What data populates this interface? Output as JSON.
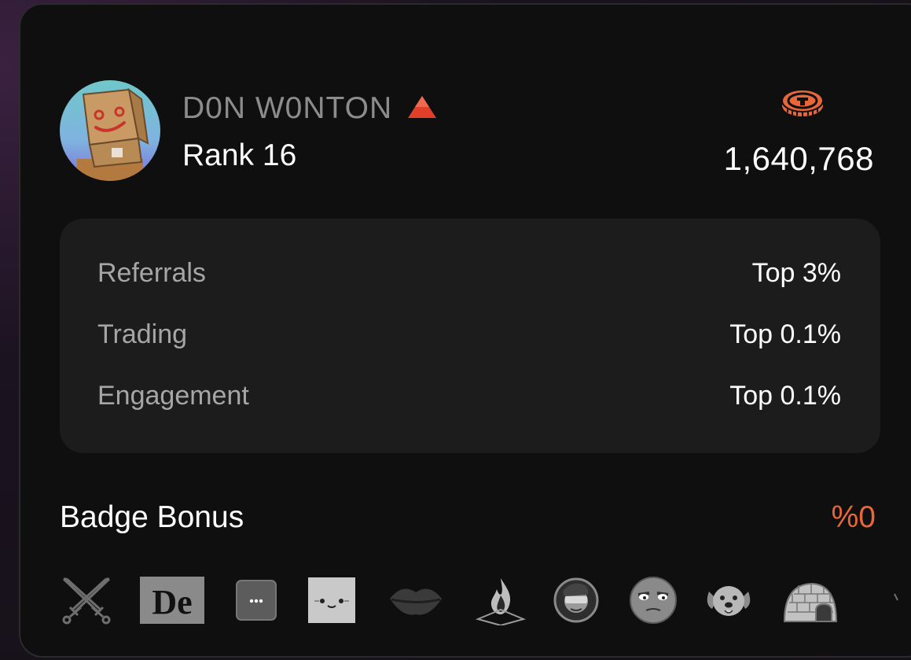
{
  "user": {
    "name": "D0N W0NTON",
    "rank_label": "Rank 16",
    "rank_trend": "up",
    "avatar": "paper-bag-head-avatar"
  },
  "points": {
    "icon": "coin-icon",
    "value": "1,640,768"
  },
  "stats": [
    {
      "label": "Referrals",
      "value": "Top 3%"
    },
    {
      "label": "Trading",
      "value": "Top 0.1%"
    },
    {
      "label": "Engagement",
      "value": "Top 0.1%"
    }
  ],
  "badge_section": {
    "title": "Badge Bonus",
    "bonus": "%0"
  },
  "badges": [
    "crossed-swords-badge",
    "de-logo-badge",
    "ellipsis-chat-badge",
    "cat-face-badge",
    "lips-badge",
    "flame-badge",
    "vr-headset-avatar-badge",
    "grumpy-face-badge",
    "dog-face-badge",
    "igloo-badge"
  ],
  "colors": {
    "accent": "#e8673a",
    "card_bg": "#0f0f10",
    "stats_bg": "#1c1c1d",
    "trend_up": "#e0402a"
  }
}
